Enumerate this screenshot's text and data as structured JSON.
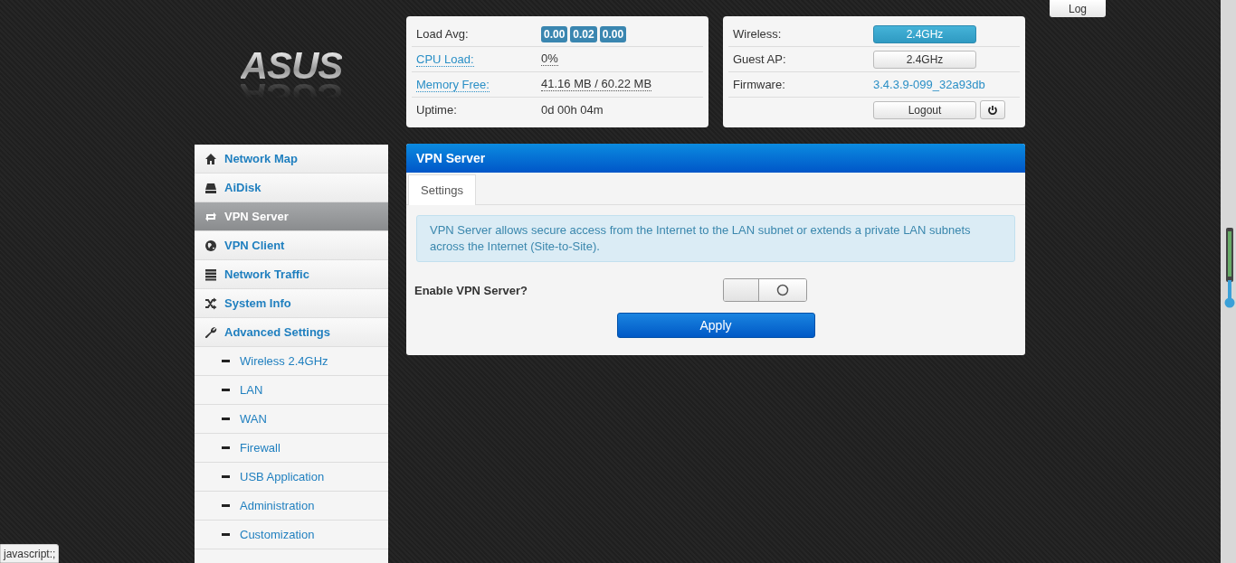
{
  "logo": {
    "text": "ASUS"
  },
  "log_button": "Log",
  "stats": {
    "rows": [
      {
        "label": "Load Avg:",
        "kind": "badges",
        "values": [
          "0.00",
          "0.02",
          "0.00"
        ]
      },
      {
        "label": "CPU Load:",
        "kind": "link",
        "value": "0%"
      },
      {
        "label": "Memory Free:",
        "kind": "link",
        "value": "41.16 MB / 60.22 MB"
      },
      {
        "label": "Uptime:",
        "kind": "plain",
        "value": "0d 00h 04m"
      }
    ]
  },
  "device": {
    "rows": [
      {
        "label": "Wireless:",
        "kind": "toggle",
        "value": "2.4GHz",
        "selected": true
      },
      {
        "label": "Guest AP:",
        "kind": "toggle",
        "value": "2.4GHz",
        "selected": false
      },
      {
        "label": "Firmware:",
        "kind": "link",
        "value": "3.4.3.9-099_32a93db"
      }
    ],
    "logout": "Logout"
  },
  "sidebar": {
    "items": [
      {
        "label": "Network Map",
        "selected": false
      },
      {
        "label": "AiDisk",
        "selected": false
      },
      {
        "label": "VPN Server",
        "selected": true
      },
      {
        "label": "VPN Client",
        "selected": false
      },
      {
        "label": "Network Traffic",
        "selected": false
      },
      {
        "label": "System Info",
        "selected": false
      },
      {
        "label": "Advanced Settings",
        "selected": false,
        "children": [
          {
            "label": "Wireless 2.4GHz",
            "selected": false
          },
          {
            "label": "LAN",
            "selected": false
          },
          {
            "label": "WAN",
            "selected": false
          },
          {
            "label": "Firewall",
            "selected": false
          },
          {
            "label": "USB Application",
            "selected": false
          },
          {
            "label": "Administration",
            "selected": false
          },
          {
            "label": "Customization",
            "selected": false
          }
        ]
      }
    ]
  },
  "panel": {
    "title": "VPN Server",
    "tabs": [
      {
        "label": "Settings",
        "selected": true
      }
    ],
    "info": "VPN Server allows secure access from the Internet to the LAN subnet or extends a private LAN subnets across the Internet (Site-to-Site).",
    "setting": {
      "label": "Enable VPN Server?",
      "on": false
    },
    "apply": "Apply"
  },
  "status_tip": "javascript:;"
}
